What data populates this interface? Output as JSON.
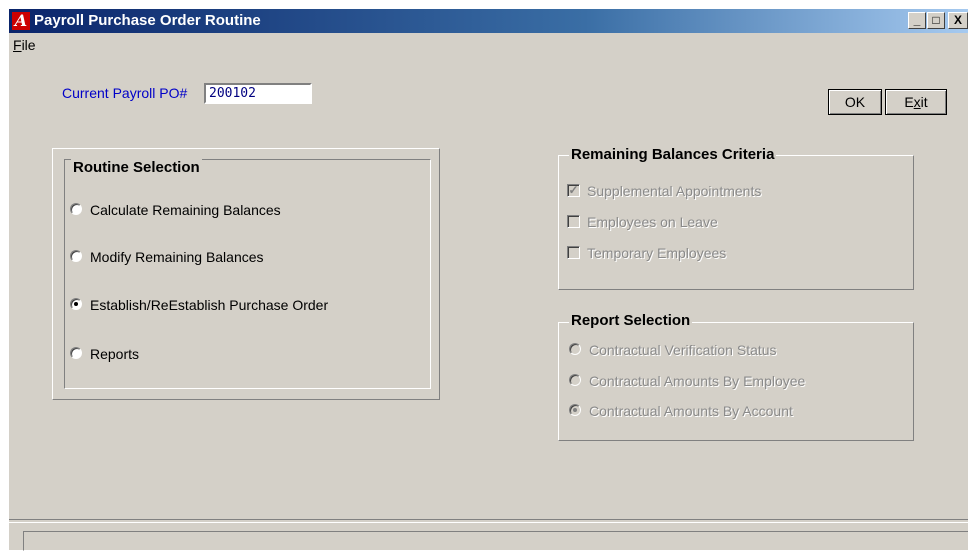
{
  "window": {
    "title": "Payroll Purchase Order Routine",
    "app_icon_letter": "A",
    "minimize_glyph": "_",
    "maximize_glyph": "□",
    "close_glyph": "X"
  },
  "menu": {
    "file_mnemonic": "F",
    "file_rest": "ile"
  },
  "po": {
    "label": "Current Payroll PO#",
    "value": "200102"
  },
  "buttons": {
    "ok": "OK",
    "exit_pre": "E",
    "exit_mnemonic": "x",
    "exit_post": "it"
  },
  "routine_selection": {
    "title": "Routine Selection",
    "options": [
      {
        "label": "Calculate Remaining Balances",
        "selected": false
      },
      {
        "label": "Modify Remaining Balances",
        "selected": false
      },
      {
        "label": "Establish/ReEstablish Purchase Order",
        "selected": true
      },
      {
        "label": "Reports",
        "selected": false
      }
    ]
  },
  "remaining_balances_criteria": {
    "title": "Remaining Balances Criteria",
    "enabled": false,
    "options": [
      {
        "label": "Supplemental Appointments",
        "checked": true
      },
      {
        "label": "Employees on Leave",
        "checked": false
      },
      {
        "label": "Temporary Employees",
        "checked": false
      }
    ]
  },
  "report_selection": {
    "title": "Report Selection",
    "enabled": false,
    "options": [
      {
        "label": "Contractual Verification Status",
        "selected": false
      },
      {
        "label": "Contractual Amounts By Employee",
        "selected": false
      },
      {
        "label": "Contractual Amounts By Account",
        "selected": true
      }
    ]
  },
  "colors": {
    "face": "#d4d0c8",
    "title_start": "#0a246a",
    "label_blue": "#0000c8"
  }
}
